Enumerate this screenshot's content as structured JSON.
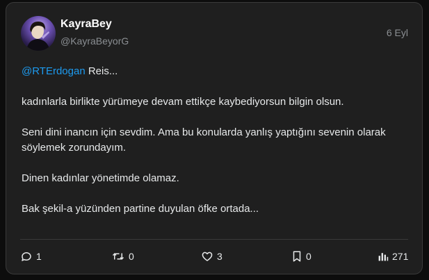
{
  "tweet": {
    "author_name": "KayraBey",
    "author_handle": "@KayraBeyorG",
    "date": "6 Eyl",
    "mention": "@RTErdogan",
    "line1_rest": " Reis...",
    "paragraph2": "kadınlarla birlikte yürümeye devam ettikçe kaybediyorsun bilgin olsun.",
    "paragraph3_line1": "Seni dini inancın için sevdim. Ama bu konularda yanlış yaptığını sevenin olarak",
    "paragraph3_line2": "söylemek zorundayım.",
    "paragraph4": "Dinen kadınlar yönetimde olamaz.",
    "paragraph5": "Bak şekil-a yüzünden partine duyulan öfke ortada..."
  },
  "actions": {
    "reply_count": "1",
    "retweet_count": "0",
    "like_count": "3",
    "bookmark_count": "0",
    "views_count": "271"
  },
  "icons": {
    "reply": "reply-icon",
    "retweet": "retweet-icon",
    "like": "heart-icon",
    "bookmark": "bookmark-icon",
    "views": "views-icon"
  },
  "colors": {
    "background": "#0d0d0d",
    "card": "#1f1f1f",
    "mention": "#1d9bf0",
    "muted": "#8b8f93"
  }
}
